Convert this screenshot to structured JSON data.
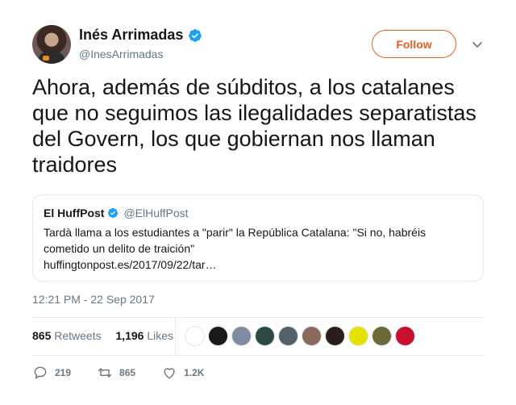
{
  "author": {
    "display_name": "Inés Arrimadas",
    "handle": "@InesArrimadas"
  },
  "follow_label": "Follow",
  "tweet_text": "Ahora, además de súbditos, a los catalanes que no seguimos las ilegalidades separatistas del Govern, los que gobiernan nos llaman traidores",
  "quoted": {
    "display_name": "El HuffPost",
    "handle": "@ElHuffPost",
    "text_line1": "Tardà llama a los estudiantes a \"parir\" la República Catalana: \"Si no, habréis",
    "text_line2": "cometido un delito de traición\"",
    "text_line3": "huffingtonpost.es/2017/09/22/tar…"
  },
  "timestamp": "12:21 PM - 22 Sep 2017",
  "stats": {
    "retweets_count": "865",
    "retweets_label": "Retweets",
    "likes_count": "1,196",
    "likes_label": "Likes"
  },
  "actions": {
    "reply_count": "219",
    "retweet_count": "865",
    "like_count": "1.2K"
  },
  "colors": {
    "accent": "#e5601f",
    "verified": "#1da1f2",
    "muted": "#657786"
  },
  "liker_avatars": [
    {
      "name": "liker-avatar-1",
      "color": "#ffffff"
    },
    {
      "name": "liker-avatar-2",
      "color": "#1a1a1a"
    },
    {
      "name": "liker-avatar-3",
      "color": "#7d8ca0"
    },
    {
      "name": "liker-avatar-4",
      "color": "#2f4a44"
    },
    {
      "name": "liker-avatar-5",
      "color": "#55606a"
    },
    {
      "name": "liker-avatar-6",
      "color": "#8a6a5a"
    },
    {
      "name": "liker-avatar-7",
      "color": "#2b1d1a"
    },
    {
      "name": "liker-avatar-8",
      "color": "#e6e200"
    },
    {
      "name": "liker-avatar-9",
      "color": "#6b6b3a"
    },
    {
      "name": "liker-avatar-10",
      "color": "#c8102e"
    }
  ]
}
